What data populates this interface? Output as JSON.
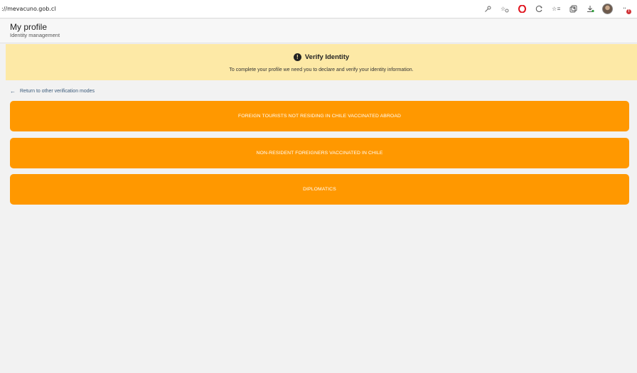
{
  "browser": {
    "url": "://mevacuno.gob.cl",
    "icons": [
      "key-icon",
      "reader-add-icon",
      "opera-icon",
      "extension-icon",
      "favorites-icon",
      "collections-icon",
      "download-icon",
      "profile-avatar",
      "more-icon"
    ],
    "notification_badge": "!"
  },
  "header": {
    "title": "My profile",
    "subtitle": "Identity management"
  },
  "banner": {
    "icon_glyph": "!",
    "title": "Verify Identity",
    "text": "To complete your profile we need you to declare and verify your identity information.",
    "background": "#fde9a6"
  },
  "back_link": {
    "arrow": "←",
    "label": "Return to other verification modes"
  },
  "options": [
    {
      "label": "FOREIGN TOURISTS NOT RESIDING IN CHILE VACCINATED ABROAD"
    },
    {
      "label": "NON-RESIDENT FOREIGNERS VACCINATED IN CHILE"
    },
    {
      "label": "DIPLOMATICS"
    }
  ],
  "colors": {
    "accent": "#ff9800",
    "link": "#3a5a7a"
  }
}
